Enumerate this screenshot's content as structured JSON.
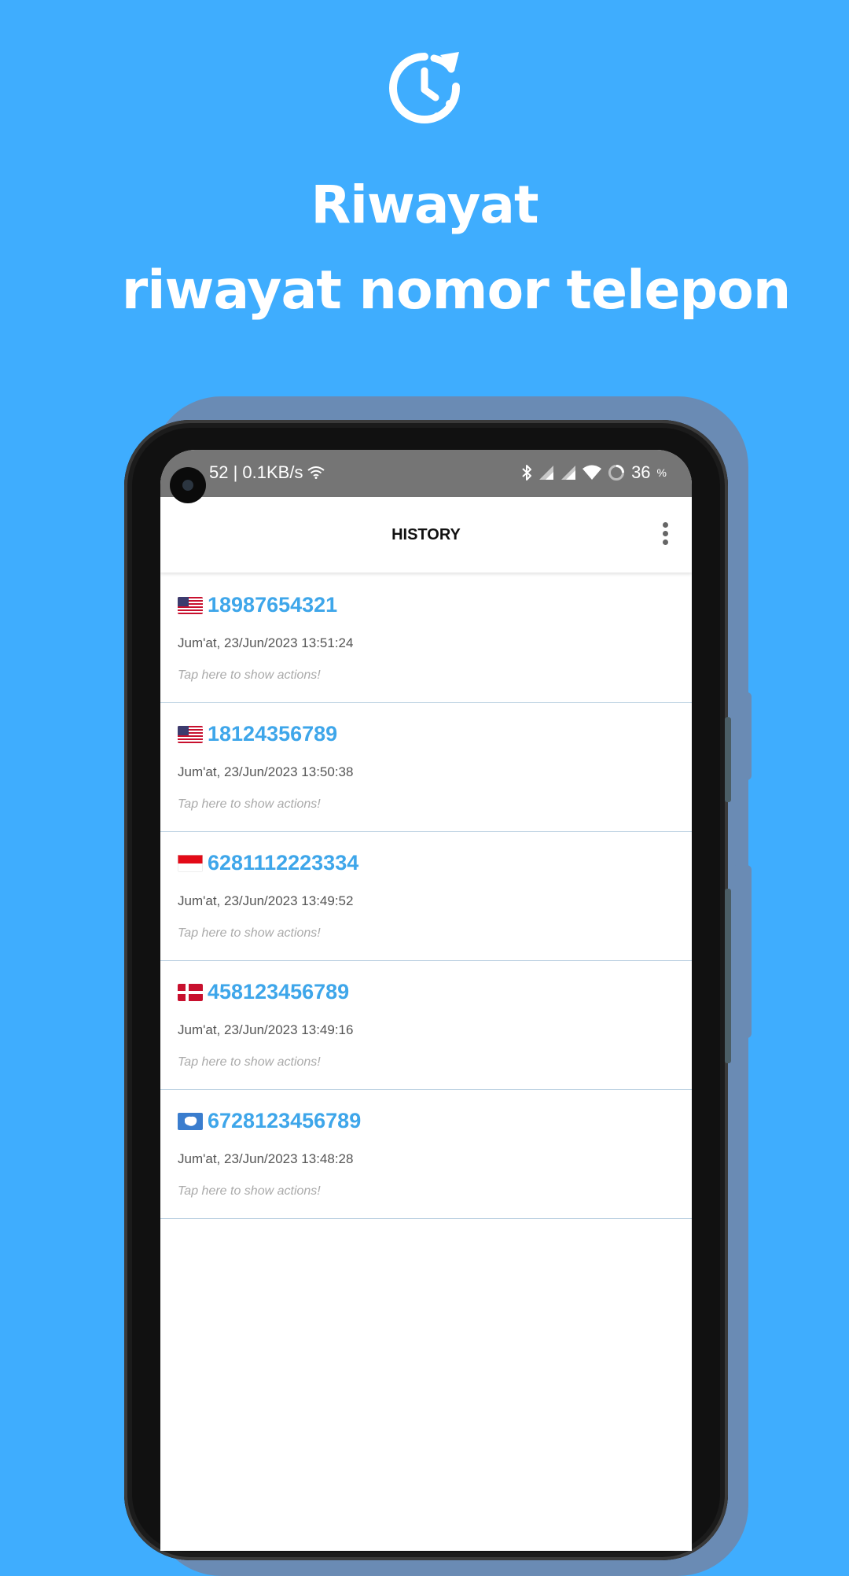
{
  "promo": {
    "icon": "clock-history-icon",
    "title": "Riwayat",
    "subtitle": "riwayat nomor telepon"
  },
  "status_bar": {
    "time_speed": "52 | 0.1KB/s",
    "battery": "36",
    "battery_unit": "%",
    "icons": [
      "wifi-icon",
      "bluetooth-icon",
      "signal-icon",
      "signal-icon",
      "wifi-icon",
      "battery-icon"
    ]
  },
  "app_bar": {
    "title": "HISTORY",
    "menu_icon": "more-vert-icon"
  },
  "history": [
    {
      "flag": "us-flag-icon",
      "number": "18987654321",
      "date": "Jum'at, 23/Jun/2023 13:51:24",
      "hint": "Tap here to show actions!"
    },
    {
      "flag": "us-flag-icon",
      "number": "18124356789",
      "date": "Jum'at, 23/Jun/2023 13:50:38",
      "hint": "Tap here to show actions!"
    },
    {
      "flag": "id-flag-icon",
      "number": "6281112223334",
      "date": "Jum'at, 23/Jun/2023 13:49:52",
      "hint": "Tap here to show actions!"
    },
    {
      "flag": "dk-flag-icon",
      "number": "458123456789",
      "date": "Jum'at, 23/Jun/2023 13:49:16",
      "hint": "Tap here to show actions!"
    },
    {
      "flag": "aq-flag-icon",
      "number": "6728123456789",
      "date": "Jum'at, 23/Jun/2023 13:48:28",
      "hint": "Tap here to show actions!"
    }
  ],
  "colors": {
    "background": "#3fadfe",
    "accent": "#3ea6ea",
    "status_bar": "#757575"
  }
}
